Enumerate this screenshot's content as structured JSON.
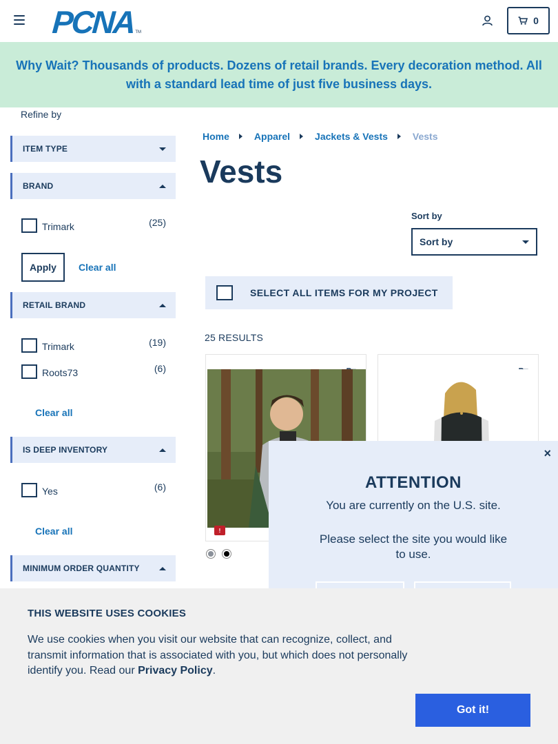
{
  "header": {
    "logo_text": "PCNA",
    "logo_tm": "TM",
    "cart_count": "0"
  },
  "banner": {
    "text": "Why Wait? Thousands of products. Dozens of retail brands. Every decoration method. All with a standard lead time of just five business days."
  },
  "sidebar": {
    "refine_label": "Refine by",
    "facets": {
      "item_type": {
        "title": "ITEM TYPE"
      },
      "brand": {
        "title": "BRAND",
        "options": [
          {
            "label": "Trimark",
            "count": "(25)"
          }
        ],
        "apply_label": "Apply",
        "clear_label": "Clear all"
      },
      "retail_brand": {
        "title": "RETAIL BRAND",
        "options": [
          {
            "label": "Trimark",
            "count": "(19)"
          },
          {
            "label": "Roots73",
            "count": "(6)"
          }
        ],
        "clear_label": "Clear all"
      },
      "deep_inventory": {
        "title": "IS DEEP INVENTORY",
        "options": [
          {
            "label": "Yes",
            "count": "(6)"
          }
        ],
        "clear_label": "Clear all"
      },
      "min_order": {
        "title": "MINIMUM ORDER QUANTITY"
      }
    }
  },
  "main": {
    "breadcrumb": [
      "Home",
      "Apparel",
      "Jackets & Vests",
      "Vests"
    ],
    "title": "Vests",
    "sort": {
      "label": "Sort by",
      "value": "Sort by"
    },
    "select_all_label": "SELECT ALL ITEMS FOR MY PROJECT",
    "results_count": "25 RESULTS",
    "products": [
      {
        "badge": "!",
        "swatches": [
          "#8a9099",
          "#000000"
        ]
      },
      {
        "badge": ""
      }
    ]
  },
  "modal": {
    "close": "×",
    "title": "ATTENTION",
    "line1": "You are currently on the U.S. site.",
    "line2": "Please select the site you would like to use."
  },
  "cookie": {
    "title": "THIS WEBSITE USES COOKIES",
    "text_before": "We use cookies when you visit our website that can recognize, collect, and transmit information that is associated with you, but which does not personally identify you. Read our ",
    "link": "Privacy Policy",
    "text_after": ".",
    "button": "Got it!"
  }
}
